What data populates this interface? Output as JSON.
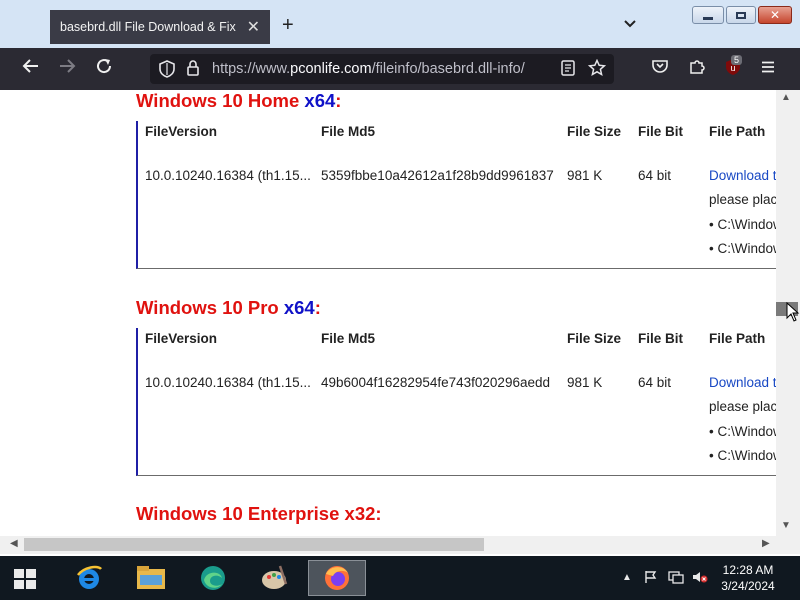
{
  "browser": {
    "tab_title": "basebrd.dll File Download & Fix For",
    "tab_close": "✕",
    "new_tab": "+",
    "tab_list": "⌄",
    "url_prefix": "https://www.",
    "url_host": "pconlife.com",
    "url_path": "/fileinfo/basebrd.dll-info/",
    "extension_badge": "5"
  },
  "page": {
    "sections": [
      {
        "heading_name": "Windows 10 Home ",
        "heading_arch": "x64",
        "heading_colon": ":",
        "table": {
          "headers": [
            "FileVersion",
            "File Md5",
            "File Size",
            "File Bit",
            "File Path"
          ],
          "version": "10.0.10240.16384 (th1.15...",
          "md5": "5359fbbe10a42612a1f28b9dd9961837",
          "size": "981 K",
          "bit": "64 bit",
          "download": "Download t",
          "place": "please plac",
          "path1": "• C:\\Window",
          "path2": "• C:\\Window"
        }
      },
      {
        "heading_name": "Windows 10 Pro ",
        "heading_arch": "x64",
        "heading_colon": ":",
        "table": {
          "headers": [
            "FileVersion",
            "File Md5",
            "File Size",
            "File Bit",
            "File Path"
          ],
          "version": "10.0.10240.16384 (th1.15...",
          "md5": "49b6004f16282954fe743f020296aedd",
          "size": "981 K",
          "bit": "64 bit",
          "download": "Download t",
          "place": "please plac",
          "path1": "• C:\\Window",
          "path2": "• C:\\Window"
        }
      },
      {
        "heading_name": "Windows 10 Enterprise ",
        "heading_arch": "x32",
        "heading_colon": ":"
      }
    ]
  },
  "taskbar": {
    "time": "12:28 AM",
    "date": "3/24/2024"
  },
  "colors": {
    "heading_red": "#e0120f",
    "arch_blue": "#1012c8",
    "link_blue": "#1848c4",
    "table_border": "#1f1fa6"
  }
}
